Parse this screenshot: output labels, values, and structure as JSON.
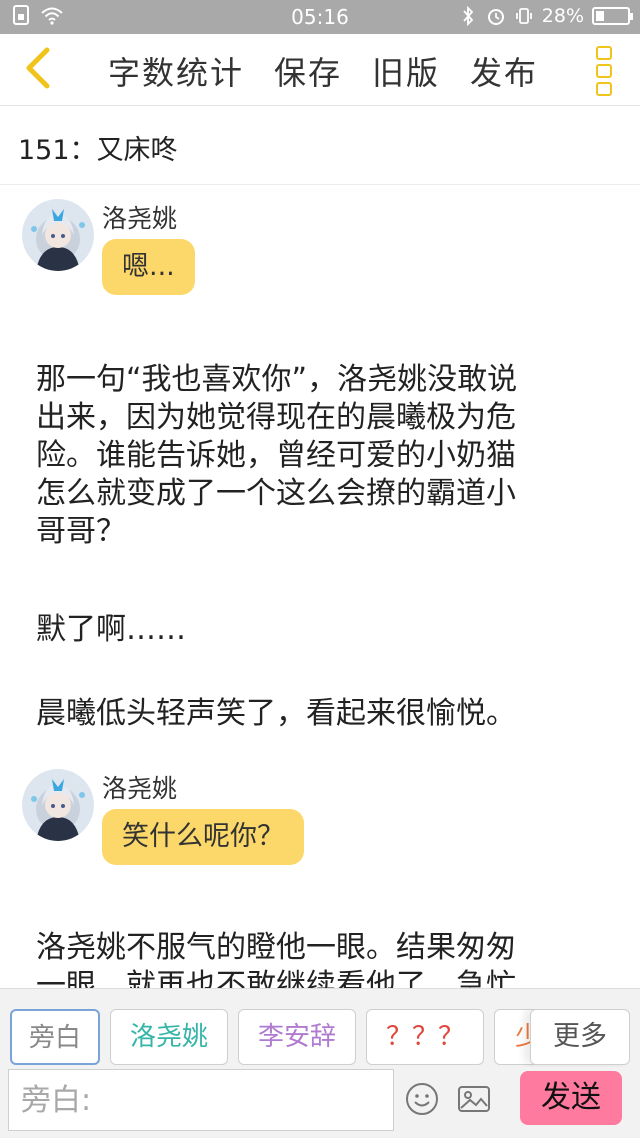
{
  "status_bar": {
    "time": "05:16",
    "battery_text": "28%",
    "battery_level": 0.28,
    "icons": [
      "sim-icon",
      "wifi-icon",
      "bluetooth-icon",
      "alarm-icon",
      "vibrate-icon",
      "battery-icon"
    ]
  },
  "nav": {
    "actions": [
      "字数统计",
      "保存",
      "旧版",
      "发布"
    ],
    "accent_color": "#f0c41b"
  },
  "chapter_title": "151：又床咚",
  "messages": [
    {
      "type": "dialogue",
      "speaker": "洛尧姚",
      "text": "嗯..."
    },
    {
      "type": "narration",
      "lines": [
        "那一句“我也喜欢你”，洛尧姚没敢说",
        "出来，因为她觉得现在的晨曦极为危",
        "险。谁能告诉她，曾经可爱的小奶猫",
        "怎么就变成了一个这么会撩的霸道小",
        "哥哥？"
      ]
    },
    {
      "type": "narration",
      "lines": [
        "默了啊……"
      ]
    },
    {
      "type": "narration",
      "lines": [
        "晨曦低头轻声笑了，看起来很愉悦。"
      ]
    },
    {
      "type": "dialogue",
      "speaker": "洛尧姚",
      "text": "笑什么呢你？"
    },
    {
      "type": "narration",
      "lines": [
        "洛尧姚不服气的瞪他一眼。结果匆匆",
        "一眼，就再也不敢继续看他了，急忙"
      ]
    }
  ],
  "roles": [
    {
      "label": "旁白",
      "color": "#888888"
    },
    {
      "label": "洛尧姚",
      "color": "#35b5a8"
    },
    {
      "label": "李安辞",
      "color": "#b07ad0"
    },
    {
      "label": "？？？",
      "color": "#e0463c"
    },
    {
      "label": "少",
      "color": "#f07a3a"
    }
  ],
  "more_label": "更多",
  "input": {
    "placeholder": "旁白:"
  },
  "send_label": "发送",
  "bubble_color": "#fcd86a",
  "send_color": "#ff7a9f"
}
